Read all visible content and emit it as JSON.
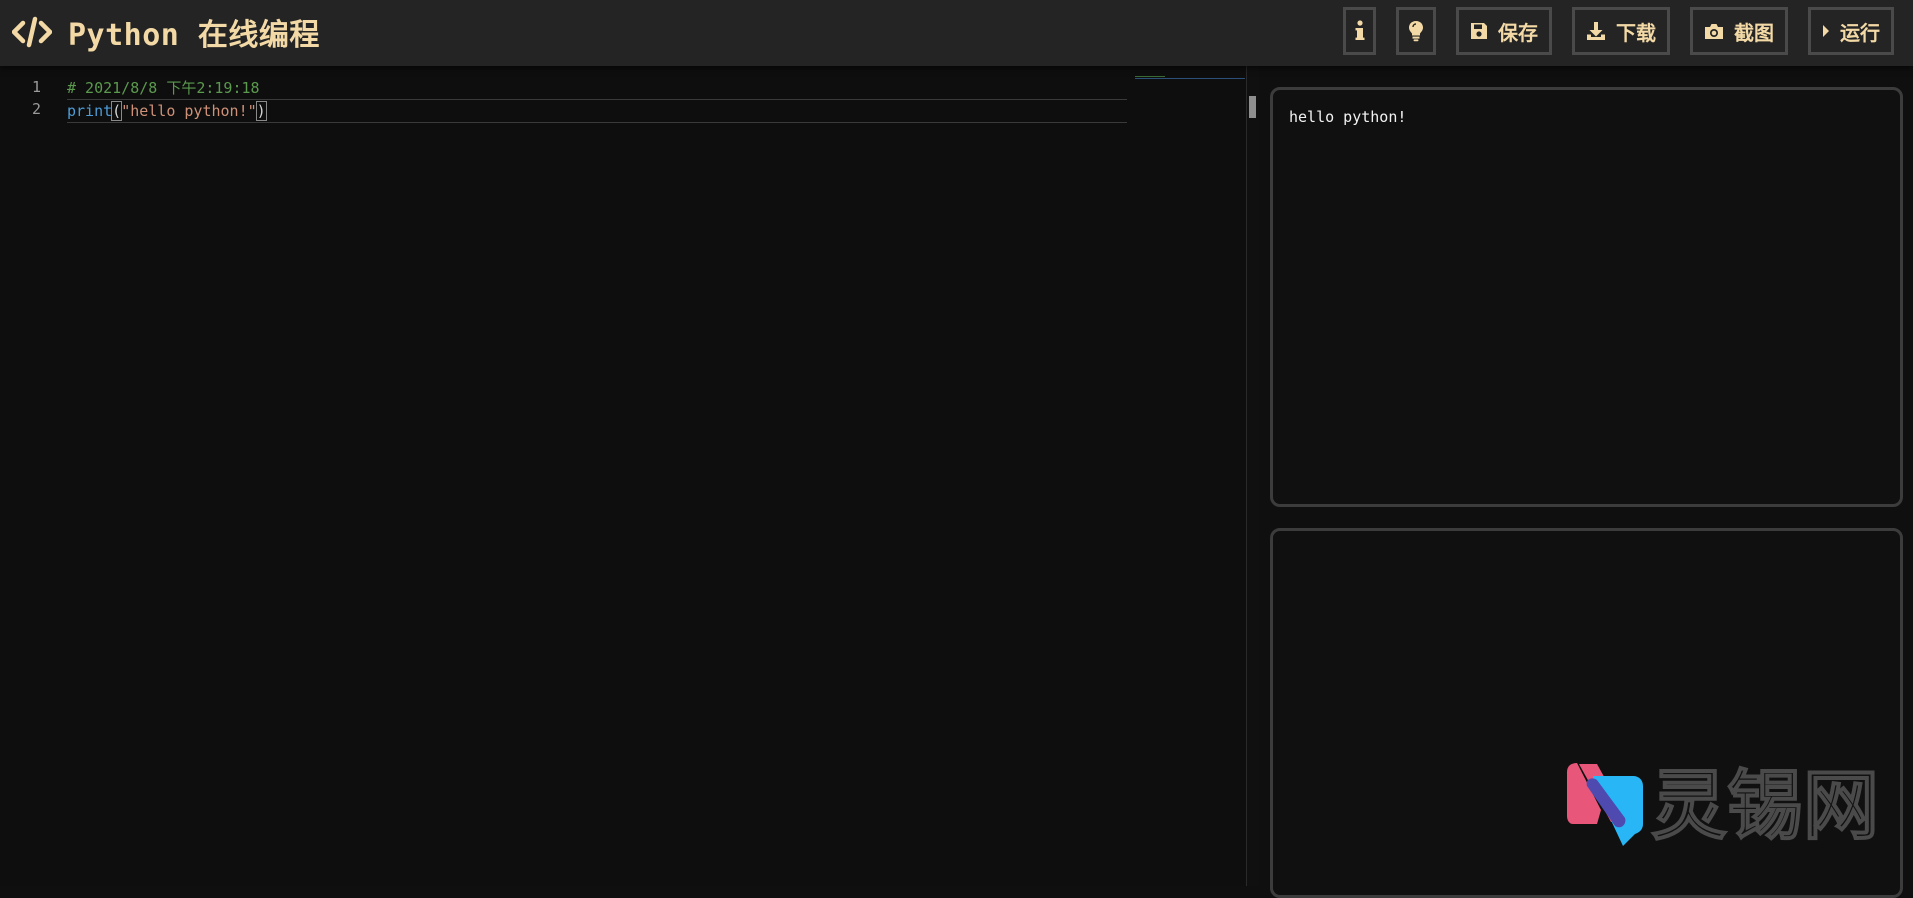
{
  "header": {
    "title": "Python 在线编程",
    "buttons": [
      {
        "id": "info",
        "label": "",
        "icon": "info-icon"
      },
      {
        "id": "tips",
        "label": "",
        "icon": "lightbulb-icon"
      },
      {
        "id": "save",
        "label": "保存",
        "icon": "floppy-disk-icon"
      },
      {
        "id": "download",
        "label": "下载",
        "icon": "download-icon"
      },
      {
        "id": "screenshot",
        "label": "截图",
        "icon": "camera-icon"
      },
      {
        "id": "run",
        "label": "运行",
        "icon": "play-icon"
      }
    ]
  },
  "editor": {
    "line_numbers": [
      "1",
      "2"
    ],
    "line1_comment": "# 2021/8/8 下午2:19:18",
    "line2": {
      "keyword": "print",
      "open_paren": "(",
      "string": "\"hello python!\"",
      "close_paren": ")"
    }
  },
  "output": {
    "text": "hello python!"
  },
  "watermark": {
    "text": "灵锡网"
  },
  "colors": {
    "header_bg": "#242424",
    "accent": "#f3d9a6",
    "editor_bg": "#0e0e0e",
    "comment": "#5b9a4e",
    "keyword": "#4e9cd6",
    "string": "#ce9178"
  }
}
